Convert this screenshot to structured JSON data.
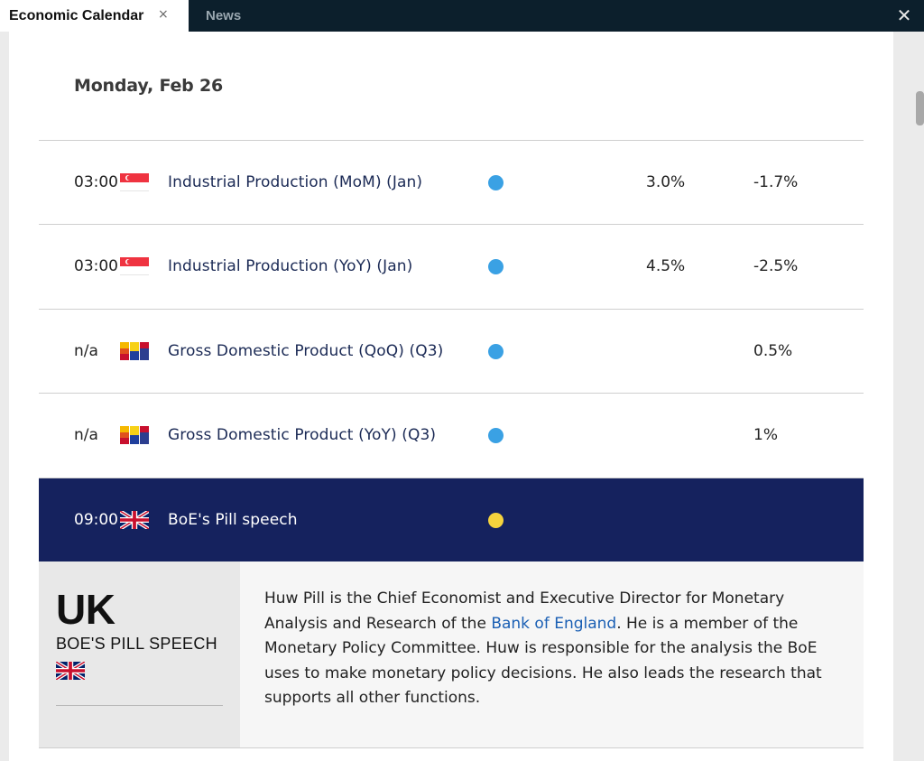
{
  "tabs": [
    {
      "label": "Economic Calendar",
      "close": "×"
    },
    {
      "label": "News"
    }
  ],
  "window_close": "✕",
  "date_heading": "Monday, Feb 26",
  "events": [
    {
      "time": "03:00",
      "flag": "singapore-flag-icon",
      "name": "Industrial Production (MoM) (Jan)",
      "impact_color": "#3aa1e4",
      "actual": "3.0%",
      "previous": "-1.7%"
    },
    {
      "time": "03:00",
      "flag": "singapore-flag-icon",
      "name": "Industrial Production (YoY) (Jan)",
      "impact_color": "#3aa1e4",
      "actual": "4.5%",
      "previous": "-2.5%"
    },
    {
      "time": "n/a",
      "flag": "multi-stripe-flag-icon",
      "name": "Gross Domestic Product (QoQ) (Q3)",
      "impact_color": "#3aa1e4",
      "actual": "",
      "previous": "0.5%"
    },
    {
      "time": "n/a",
      "flag": "multi-stripe-flag-icon",
      "name": "Gross Domestic Product (YoY) (Q3)",
      "impact_color": "#3aa1e4",
      "actual": "",
      "previous": "1%"
    },
    {
      "time": "09:00",
      "flag": "uk-flag-icon",
      "name": "BoE's Pill speech",
      "impact_color": "#f5d33d",
      "actual": "",
      "previous": "",
      "highlight_color": "#15225e"
    }
  ],
  "detail": {
    "country": "UK",
    "title": "BOE'S PILL SPEECH",
    "desc_before": "Huw Pill is the Chief Economist and Executive Director for Monetary Analysis and Research of the ",
    "desc_link": "Bank of England",
    "desc_after": ". He is a member of the Monetary Policy Committee. Huw is responsible for the analysis the BoE uses to make monetary policy decisions. He also leads the research that supports all other functions."
  }
}
